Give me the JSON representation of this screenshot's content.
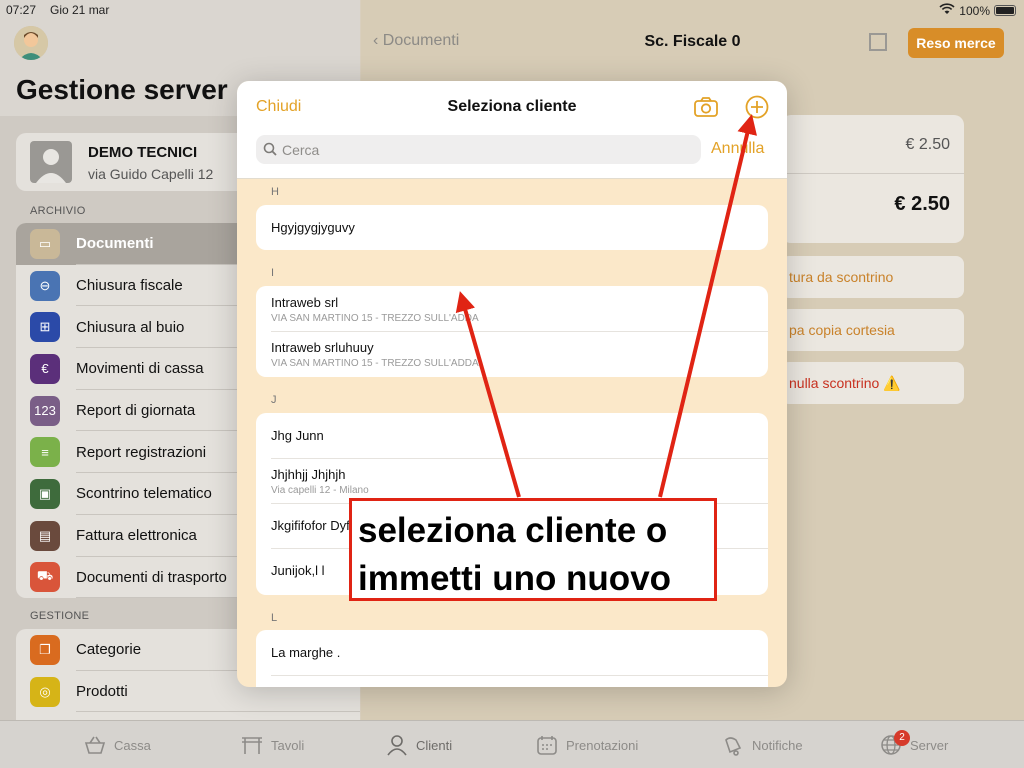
{
  "status": {
    "time": "07:27",
    "date": "Gio 21 mar",
    "battery": "100%"
  },
  "sidebar": {
    "title": "Gestione server",
    "profile": {
      "name": "DEMO TECNICI",
      "address": "via Guido Capelli 12"
    },
    "archive_label": "ARCHIVIO",
    "archive_items": [
      {
        "label": "Documenti",
        "color": "#c9b898",
        "glyph": "▭"
      },
      {
        "label": "Chiusura fiscale",
        "color": "#4a74b3",
        "glyph": "⊖"
      },
      {
        "label": "Chiusura al buio",
        "color": "#2b4aa8",
        "glyph": "⊞"
      },
      {
        "label": "Movimenti di cassa",
        "color": "#5b2f7a",
        "glyph": "€"
      },
      {
        "label": "Report di giornata",
        "color": "#7a5e87",
        "glyph": "123"
      },
      {
        "label": "Report registrazioni",
        "color": "#7bb14a",
        "glyph": "≡"
      },
      {
        "label": "Scontrino telematico",
        "color": "#3e6b3c",
        "glyph": "▣"
      },
      {
        "label": "Fattura elettronica",
        "color": "#6a4a3d",
        "glyph": "▤"
      },
      {
        "label": "Documenti di trasporto",
        "color": "#d9553a",
        "glyph": "⛟"
      }
    ],
    "gestione_label": "GESTIONE",
    "gestione_items": [
      {
        "label": "Categorie",
        "color": "#d96b1f",
        "glyph": "❐"
      },
      {
        "label": "Prodotti",
        "color": "#d6b417",
        "glyph": "◎"
      }
    ]
  },
  "main": {
    "back_label": "Documenti",
    "title": "Sc. Fiscale 0",
    "reso_button": "Reso merce",
    "subtotal": "€ 2.50",
    "total": "€ 2.50",
    "actions": [
      {
        "label": "tura da scontrino"
      },
      {
        "label": "pa copia cortesia"
      },
      {
        "label": "nulla scontrino ⚠️"
      }
    ]
  },
  "tabs": [
    {
      "label": "Cassa",
      "icon": "basket-icon"
    },
    {
      "label": "Tavoli",
      "icon": "table-icon"
    },
    {
      "label": "Clienti",
      "icon": "person-icon"
    },
    {
      "label": "Prenotazioni",
      "icon": "calendar-icon"
    },
    {
      "label": "Notifiche",
      "icon": "bell-icon"
    },
    {
      "label": "Server",
      "icon": "globe-icon",
      "badge": "2"
    }
  ],
  "modal": {
    "close_label": "Chiudi",
    "title": "Seleziona cliente",
    "search_placeholder": "Cerca",
    "cancel_label": "Annulla",
    "sections": [
      {
        "letter": "H",
        "clients": [
          {
            "name": "Hgyjgygjyguvy",
            "sub": ""
          }
        ]
      },
      {
        "letter": "I",
        "clients": [
          {
            "name": "Intraweb srl",
            "sub": "VIA SAN MARTINO 15  - TREZZO SULL'ADDA"
          },
          {
            "name": "Intraweb srluhuuy",
            "sub": "VIA SAN MARTINO 15  - TREZZO SULL'ADDA"
          }
        ]
      },
      {
        "letter": "J",
        "clients": [
          {
            "name": "Jhg Junn",
            "sub": ""
          },
          {
            "name": "Jhjhhjj Jhjhjh",
            "sub": "Via capelli 12 - Milano"
          },
          {
            "name": "Jkgififofor Dyfugu",
            "sub": ""
          },
          {
            "name": "Junijok,l  l",
            "sub": ""
          }
        ]
      },
      {
        "letter": "L",
        "clients": [
          {
            "name": "La marghe .",
            "sub": ""
          },
          {
            "name": "",
            "sub": ""
          }
        ]
      }
    ]
  },
  "annotation": {
    "line1": "seleziona cliente o",
    "line2": "immetti uno nuovo",
    "color": "#e02414"
  }
}
